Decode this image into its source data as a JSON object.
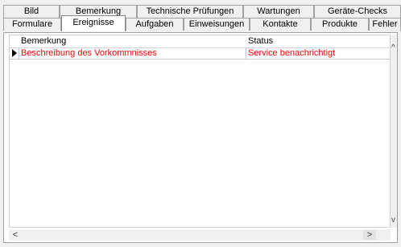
{
  "tabs_back": [
    "Bild",
    "Bemerkung",
    "Technische Prüfungen",
    "Wartungen",
    "Geräte-Checks"
  ],
  "tabs_front": [
    "Formulare",
    "Ereignisse",
    "Aufgaben",
    "Einweisungen",
    "Kontakte",
    "Produkte",
    "Fehler"
  ],
  "active_tab": "Ereignisse",
  "grid": {
    "columns": [
      "Bemerkung",
      "Status"
    ],
    "rows": [
      {
        "bemerkung": "Beschreibung des Vorkommnisses",
        "status": "Service benachrichtigt"
      }
    ]
  },
  "scroll": {
    "up": "^",
    "down": "v",
    "left": "<",
    "right": ">"
  },
  "colors": {
    "row_text": "#ff0000",
    "panel": "#ffffff",
    "background": "#f0f0f0"
  }
}
